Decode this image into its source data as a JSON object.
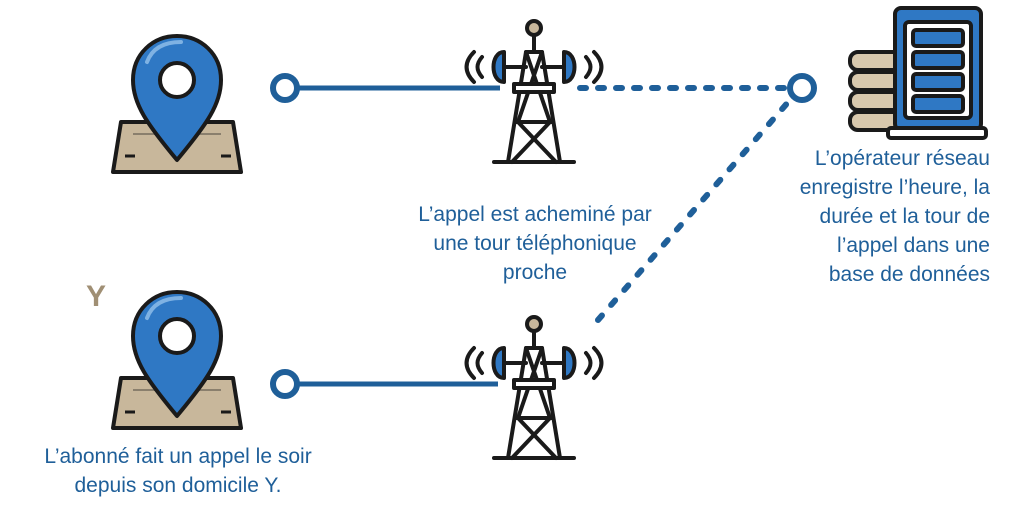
{
  "labels": {
    "tower_text": [
      "L’appel est acheminé par",
      "une tour téléphonique",
      "proche"
    ],
    "operator_text": [
      "L’opérateur réseau",
      "enregistre l’heure, la",
      "durée et la tour de",
      "l’appel dans une",
      "base de données"
    ],
    "subscriber_text": [
      "L’abonné fait un appel le soir",
      "depuis son domicile Y."
    ],
    "home_marker": "Y"
  },
  "icons": {
    "location_pin": "map-pin-icon",
    "tower": "cell-tower-icon",
    "server": "server-database-icon"
  },
  "colors": {
    "primary_blue": "#1f5f99",
    "pin_blue": "#2f78c4",
    "outline": "#1a1a1a",
    "map_tan": "#c8b79b",
    "marker_tan": "#a08f74",
    "server_stack": "#d8c8ad"
  }
}
